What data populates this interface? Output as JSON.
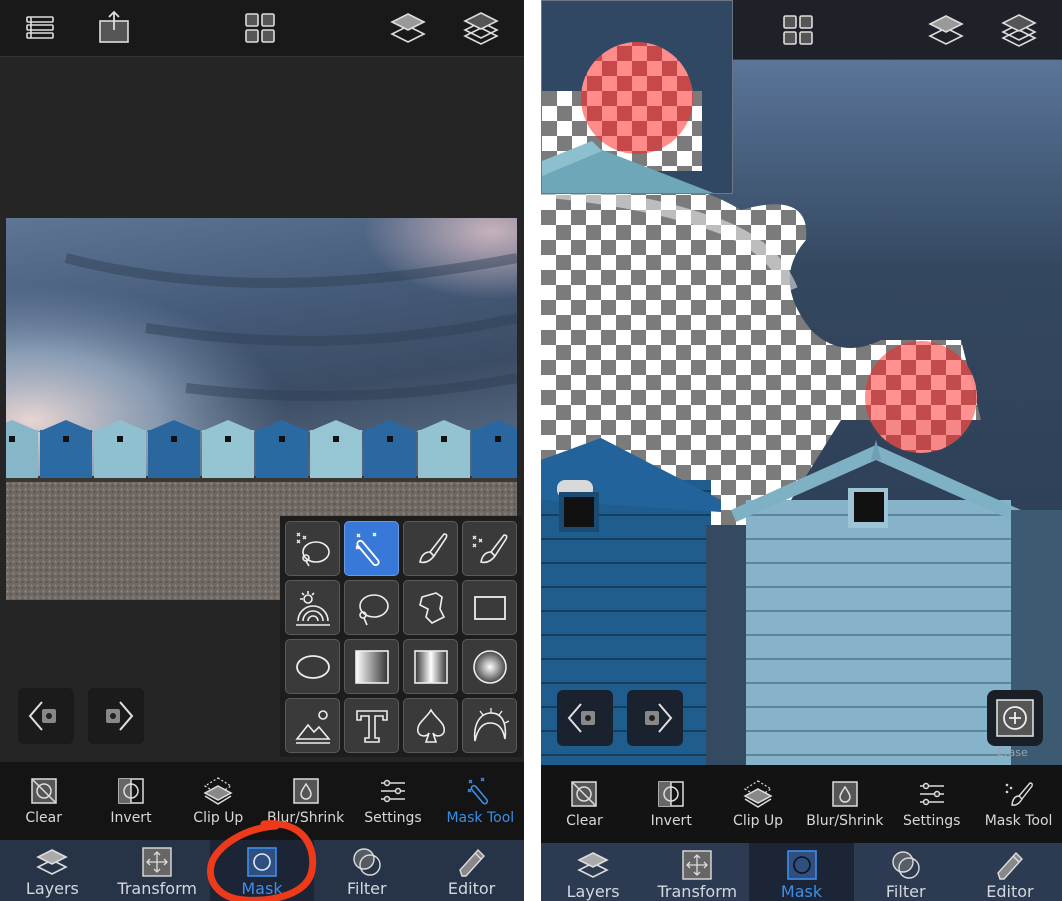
{
  "left_screen": {
    "top_bar": {
      "icons": [
        "list-icon",
        "share-icon",
        "grid-icon",
        "layer-icon",
        "layers-stack-icon"
      ]
    },
    "tool_grid": {
      "selected_index": 1,
      "tools": [
        {
          "name": "magic-lasso-tool",
          "active": false
        },
        {
          "name": "magic-wand-tool",
          "active": true
        },
        {
          "name": "brush-tool",
          "active": false
        },
        {
          "name": "magic-brush-tool",
          "active": false
        },
        {
          "name": "sky-tool",
          "active": false
        },
        {
          "name": "lasso-tool",
          "active": false
        },
        {
          "name": "polygon-lasso-tool",
          "active": false
        },
        {
          "name": "rectangle-tool",
          "active": false
        },
        {
          "name": "ellipse-tool",
          "active": false
        },
        {
          "name": "linear-gradient-tool",
          "active": false
        },
        {
          "name": "mirror-gradient-tool",
          "active": false
        },
        {
          "name": "radial-gradient-tool",
          "active": false
        },
        {
          "name": "image-tool",
          "active": false
        },
        {
          "name": "text-tool",
          "active": false
        },
        {
          "name": "shape-tool",
          "active": false
        },
        {
          "name": "hair-tool",
          "active": false
        }
      ]
    },
    "actions": [
      {
        "label": "Clear",
        "icon": "clear-icon",
        "active": false
      },
      {
        "label": "Invert",
        "icon": "invert-icon",
        "active": false
      },
      {
        "label": "Clip Up",
        "icon": "clip-up-icon",
        "active": false
      },
      {
        "label": "Blur/Shrink",
        "icon": "blur-shrink-icon",
        "active": false
      },
      {
        "label": "Settings",
        "icon": "settings-icon",
        "active": false
      },
      {
        "label": "Mask Tool",
        "icon": "magic-wand-icon",
        "active": true
      }
    ],
    "tabs": [
      {
        "label": "Layers",
        "icon": "layers-icon",
        "active": false
      },
      {
        "label": "Transform",
        "icon": "transform-icon",
        "active": false
      },
      {
        "label": "Mask",
        "icon": "mask-icon",
        "active": true
      },
      {
        "label": "Filter",
        "icon": "filter-icon",
        "active": false
      },
      {
        "label": "Editor",
        "icon": "pencil-icon",
        "active": false
      }
    ]
  },
  "right_screen": {
    "top_bar": {
      "icons": [
        "grid-icon",
        "layer-icon",
        "layers-stack-icon"
      ]
    },
    "erase_button": {
      "label": "Erase"
    },
    "actions": [
      {
        "label": "Clear",
        "icon": "clear-icon",
        "active": false
      },
      {
        "label": "Invert",
        "icon": "invert-icon",
        "active": false
      },
      {
        "label": "Clip Up",
        "icon": "clip-up-icon",
        "active": false
      },
      {
        "label": "Blur/Shrink",
        "icon": "blur-shrink-icon",
        "active": false
      },
      {
        "label": "Settings",
        "icon": "settings-icon",
        "active": false
      },
      {
        "label": "Mask Tool",
        "icon": "magic-brush-icon",
        "active": false
      }
    ],
    "tabs": [
      {
        "label": "Layers",
        "icon": "layers-icon",
        "active": false
      },
      {
        "label": "Transform",
        "icon": "transform-icon",
        "active": false
      },
      {
        "label": "Mask",
        "icon": "mask-icon",
        "active": true
      },
      {
        "label": "Filter",
        "icon": "filter-icon",
        "active": false
      },
      {
        "label": "Editor",
        "icon": "pencil-icon",
        "active": false
      }
    ]
  },
  "colors": {
    "accent": "#3a8ee8",
    "active_tool_bg": "#3878d8",
    "annotation": "#ee3a1a",
    "tab_bar": "#273448",
    "mask_overlay": "#ff5a5a"
  }
}
